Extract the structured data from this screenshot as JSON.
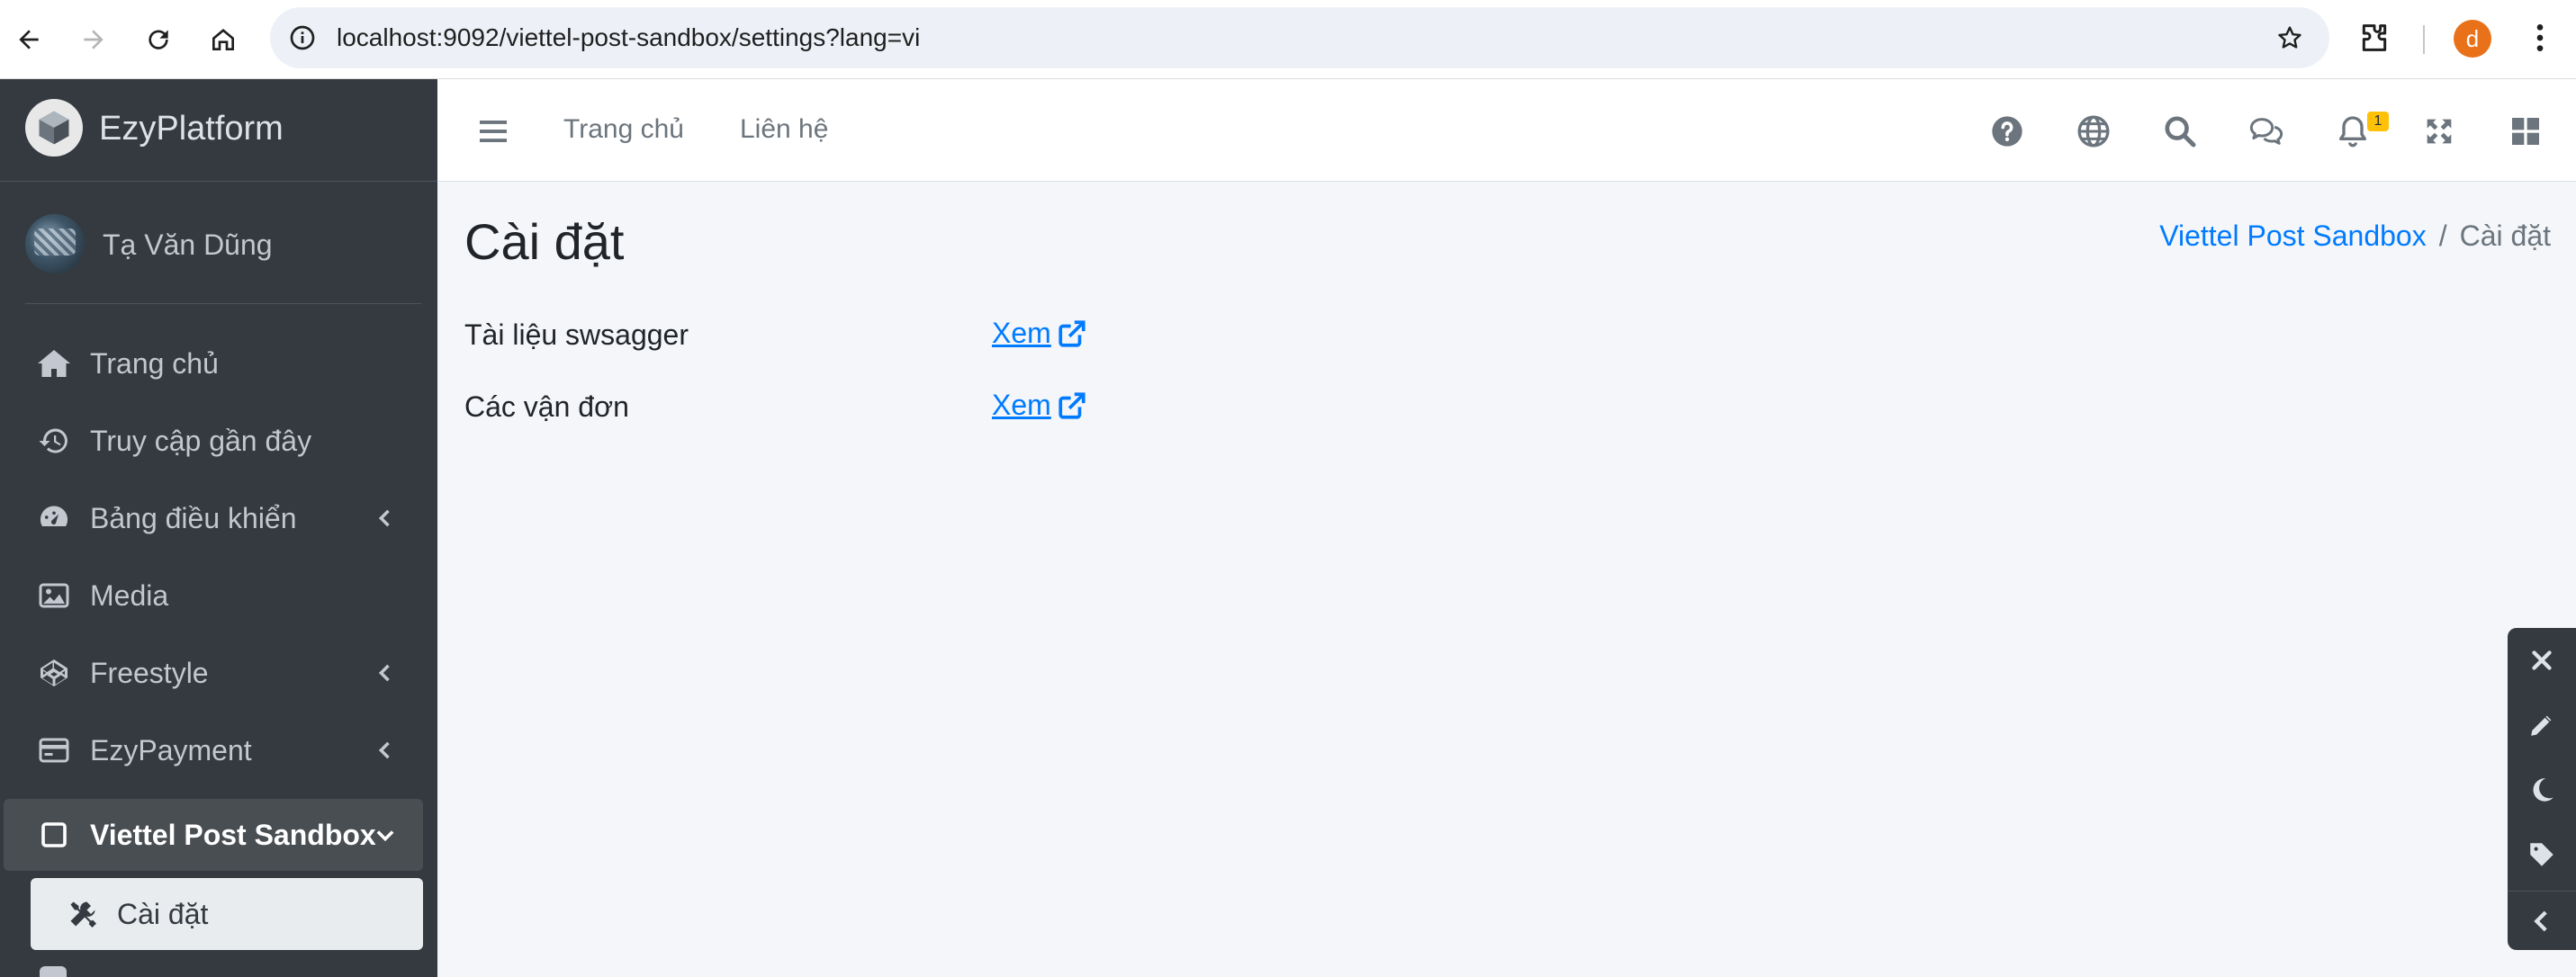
{
  "browser": {
    "url": "localhost:9092/viettel-post-sandbox/settings?lang=vi",
    "profile_initial": "d"
  },
  "sidebar": {
    "brand": "EzyPlatform",
    "user_name": "Tạ Văn Dũng",
    "items": [
      {
        "label": "Trang chủ",
        "icon": "home-icon"
      },
      {
        "label": "Truy cập gần đây",
        "icon": "history-icon"
      },
      {
        "label": "Bảng điều khiển",
        "icon": "dashboard-gauge-icon",
        "expandable": true
      },
      {
        "label": "Media",
        "icon": "image-icon"
      },
      {
        "label": "Freestyle",
        "icon": "codepen-icon",
        "expandable": true
      },
      {
        "label": "EzyPayment",
        "icon": "credit-card-icon",
        "expandable": true
      },
      {
        "label": "Viettel Post Sandbox",
        "icon": "square-icon",
        "expanded": true
      }
    ],
    "sub_items": [
      {
        "label": "Cài đặt",
        "icon": "tools-icon",
        "active": true
      }
    ]
  },
  "topbar": {
    "links": [
      "Trang chủ",
      "Liên hệ"
    ],
    "icons": [
      "help-icon",
      "globe-icon",
      "search-icon",
      "chat-icon",
      "bell-icon",
      "fullscreen-icon",
      "grid-icon"
    ],
    "notification_count": "1"
  },
  "page": {
    "title": "Cài đặt",
    "breadcrumb": [
      "Viettel Post Sandbox",
      "Cài đặt"
    ],
    "rows": [
      {
        "label": "Tài liệu swsagger",
        "link": "Xem"
      },
      {
        "label": "Các vận đơn",
        "link": "Xem"
      }
    ]
  },
  "floating_toolbar": [
    "close-icon",
    "pencil-icon",
    "moon-icon",
    "tag-icon",
    "chevron-left-icon"
  ],
  "colors": {
    "sidebar_bg": "#343a40",
    "link": "#007bff",
    "badge": "#ffc107",
    "profile": "#e8711a"
  }
}
